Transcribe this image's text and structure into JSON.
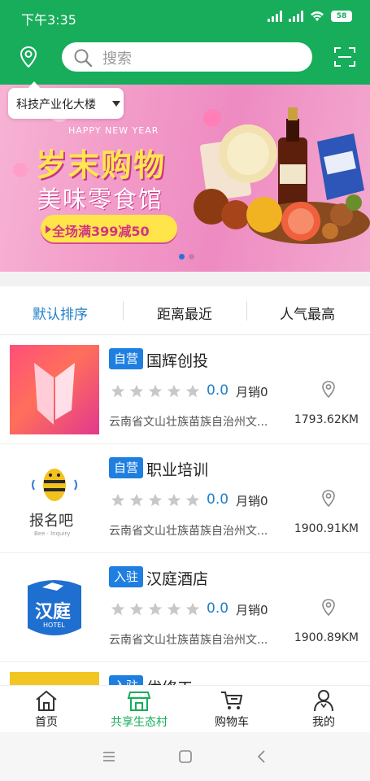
{
  "status": {
    "time": "下午3:35",
    "battery": "58"
  },
  "header": {
    "search_placeholder": "搜索"
  },
  "location": {
    "label": "科技产业化大楼"
  },
  "banner": {
    "happy": "HAPPY NEW YEAR",
    "title": "岁末购物",
    "subtitle": "美味零食馆",
    "promo": "全场满399减50"
  },
  "sort_tabs": [
    "默认排序",
    "距离最近",
    "人气最高"
  ],
  "stores": [
    {
      "badge": "自营",
      "name": "国辉创投",
      "rating": "0.0",
      "sales": "月销0",
      "address": "云南省文山壮族苗族自治州文...",
      "distance": "1793.62KM"
    },
    {
      "badge": "自营",
      "name": "职业培训",
      "rating": "0.0",
      "sales": "月销0",
      "address": "云南省文山壮族苗族自治州文...",
      "distance": "1900.91KM",
      "logo_text": "报名吧",
      "logo_sub": "Bee · Inquiry"
    },
    {
      "badge": "入驻",
      "name": "汉庭酒店",
      "rating": "0.0",
      "sales": "月销0",
      "address": "云南省文山壮族苗族自治州文...",
      "distance": "1900.89KM",
      "logo_text": "汉庭",
      "logo_sub": "HOTEL"
    },
    {
      "badge": "入驻",
      "name": "优修工"
    }
  ],
  "bottom_nav": [
    "首页",
    "共享生态村",
    "购物车",
    "我的"
  ],
  "colors": {
    "primary": "#17ad5a",
    "accent_blue": "#1f7fe0"
  }
}
